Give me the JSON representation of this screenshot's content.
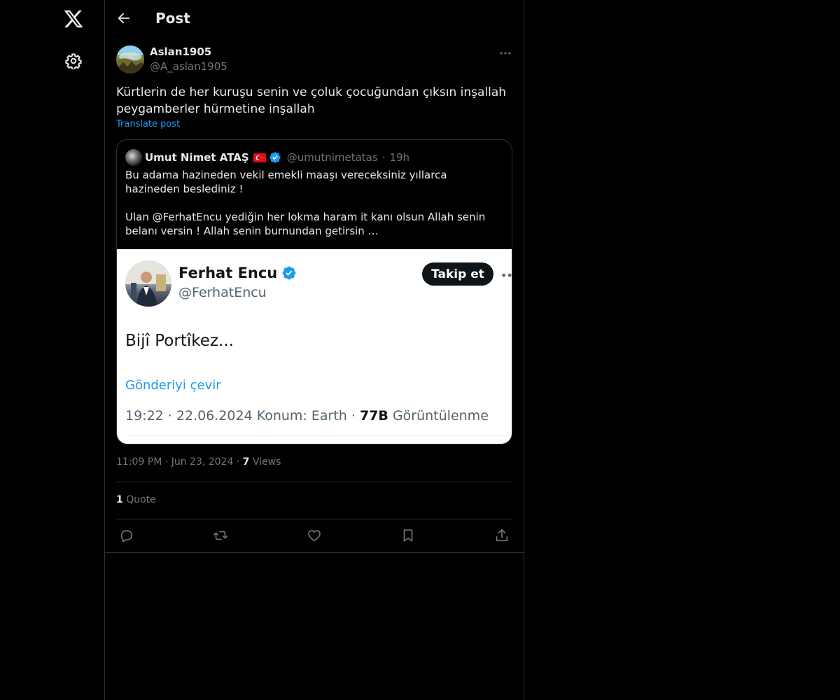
{
  "header": {
    "title": "Post"
  },
  "post": {
    "display_name": "Aslan1905",
    "handle": "@A_aslan1905",
    "text": "Kürtlerin de her kuruşu senin ve çoluk çocuğundan çıksın inşallah peygamberler hürmetine inşallah",
    "translate_label": "Translate post",
    "time": "11:09 PM",
    "date": "Jun 23, 2024",
    "views_count": "7",
    "views_label": "Views",
    "quotes_count": "1",
    "quotes_label": "Quote"
  },
  "quoted_post": {
    "display_name": "Umut Nimet ATAŞ",
    "handle": "@umutnimetatas",
    "time_ago": "19h",
    "text": "Bu adama hazineden vekil emekli maaşı vereceksiniz yıllarca hazineden beslediniz !\n\nUlan @FerhatEncu yediğin her lokma haram it kanı olsun Allah senin belanı versin ! Allah senin burnundan getirsin …",
    "image": {
      "display_name": "Ferhat Encu",
      "handle": "@FerhatEncu",
      "follow_label": "Takip et",
      "text": "Bijî Portîkez...",
      "translate_label": "Gönderiyi çevir",
      "meta_prefix": "19:22 · 22.06.2024 Konum: Earth · ",
      "views_count": "77B",
      "views_label": "Görüntülenme"
    }
  },
  "icons": {
    "logo": "x-logo-icon",
    "settings": "gear-icon",
    "back": "back-arrow-icon",
    "more": "more-horizontal-icon",
    "reply": "reply-icon",
    "repost": "repost-icon",
    "like": "heart-icon",
    "bookmark": "bookmark-icon",
    "share": "share-icon",
    "verified": "verified-badge-icon",
    "flag": "turkey-flag-icon"
  },
  "colors": {
    "background": "#000000",
    "text_primary": "#e7e9ea",
    "text_secondary": "#71767b",
    "border": "#2f3336",
    "accent": "#1d9bf0"
  }
}
